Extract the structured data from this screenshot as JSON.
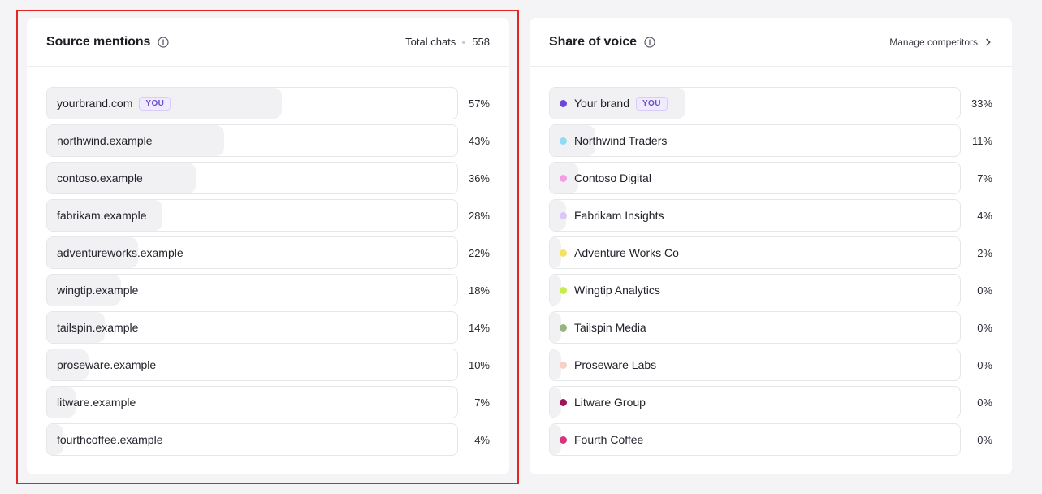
{
  "source_mentions": {
    "title": "Source mentions",
    "total_label": "Total chats",
    "total_value": "558",
    "badge_label": "YOU",
    "items": [
      {
        "label": "yourbrand.com",
        "pct": "57%",
        "value": 57,
        "you": true
      },
      {
        "label": "northwind.example",
        "pct": "43%",
        "value": 43,
        "you": false
      },
      {
        "label": "contoso.example",
        "pct": "36%",
        "value": 36,
        "you": false
      },
      {
        "label": "fabrikam.example",
        "pct": "28%",
        "value": 28,
        "you": false
      },
      {
        "label": "adventureworks.example",
        "pct": "22%",
        "value": 22,
        "you": false
      },
      {
        "label": "wingtip.example",
        "pct": "18%",
        "value": 18,
        "you": false
      },
      {
        "label": "tailspin.example",
        "pct": "14%",
        "value": 14,
        "you": false
      },
      {
        "label": "proseware.example",
        "pct": "10%",
        "value": 10,
        "you": false
      },
      {
        "label": "litware.example",
        "pct": "7%",
        "value": 7,
        "you": false
      },
      {
        "label": "fourthcoffee.example",
        "pct": "4%",
        "value": 4,
        "you": false
      }
    ]
  },
  "share_of_voice": {
    "title": "Share of voice",
    "manage_label": "Manage competitors",
    "badge_label": "YOU",
    "items": [
      {
        "label": "Your brand",
        "pct": "33%",
        "value": 33,
        "color": "#6e47d6",
        "you": true
      },
      {
        "label": "Northwind Traders",
        "pct": "11%",
        "value": 11,
        "color": "#8fdcf5",
        "you": false
      },
      {
        "label": "Contoso Digital",
        "pct": "7%",
        "value": 7,
        "color": "#f19ee6",
        "you": false
      },
      {
        "label": "Fabrikam Insights",
        "pct": "4%",
        "value": 4,
        "color": "#dcc6f5",
        "you": false
      },
      {
        "label": "Adventure Works Co",
        "pct": "2%",
        "value": 2,
        "color": "#f7e25e",
        "you": false
      },
      {
        "label": "Wingtip Analytics",
        "pct": "0%",
        "value": 0,
        "color": "#c6ec4f",
        "you": false
      },
      {
        "label": "Tailspin Media",
        "pct": "0%",
        "value": 0,
        "color": "#95b47f",
        "you": false
      },
      {
        "label": "Proseware Labs",
        "pct": "0%",
        "value": 0,
        "color": "#f8cfc6",
        "you": false
      },
      {
        "label": "Litware Group",
        "pct": "0%",
        "value": 0,
        "color": "#9b1657",
        "you": false
      },
      {
        "label": "Fourth Coffee",
        "pct": "0%",
        "value": 0,
        "color": "#d7347c",
        "you": false
      }
    ]
  },
  "icons": {
    "info": "info-icon",
    "chevron": "chevron-right-icon"
  }
}
